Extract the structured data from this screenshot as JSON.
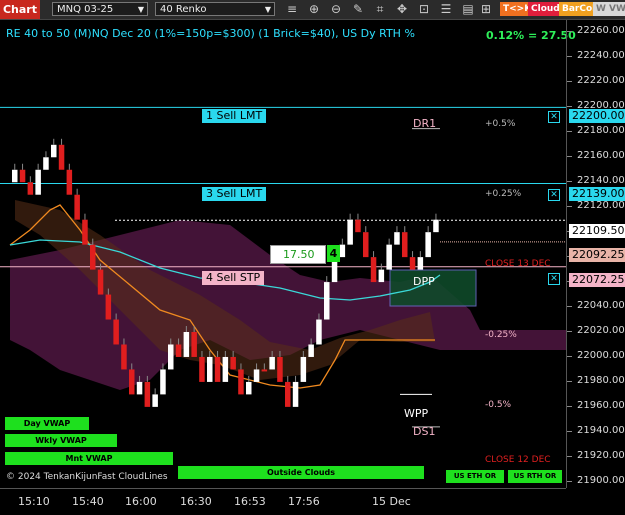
{
  "toolbar": {
    "chart_label": "Chart",
    "symbol": "MNQ 03-25",
    "bar_type": "40 Renko",
    "tags": [
      {
        "label": "T<>K",
        "bg": "#f07020",
        "fg": "#ffffff"
      },
      {
        "label": "Cloud",
        "bg": "#e01e3c",
        "fg": "#ffffff"
      },
      {
        "label": "BarCol",
        "bg": "#f0a020",
        "fg": "#ffffff"
      },
      {
        "label": "W VWA",
        "bg": "#d8d8d8",
        "fg": "#777777"
      }
    ]
  },
  "chart": {
    "title": "RE 40 to 50 (M)NQ Dec 20 (1%=150p=$300) (1 Brick=$40), US Dy RTH %",
    "pct_change": "0.12% = 27.50",
    "orders": [
      {
        "label": "1 Sell LMT",
        "price": "22200.00",
        "kind": "lmt"
      },
      {
        "label": "3 Sell LMT",
        "price": "22139.00",
        "kind": "lmt"
      },
      {
        "label": "4 Sell STP",
        "price": "22072.25",
        "kind": "stp"
      }
    ],
    "qty_value": "17.50",
    "qty_count": "4",
    "last_price": "22109.50",
    "close_13_price": "22092.25",
    "levels": {
      "dr1": "DR1",
      "dpp": "DPP",
      "wpp": "WPP",
      "ds1": "DS1",
      "p05": "+0.5%",
      "p025": "+0.25%",
      "m025": "-0.25%",
      "m05": "-0.5%",
      "close13": "CLOSE 13 DEC",
      "close12": "CLOSE 12 DEC"
    },
    "buttons": {
      "day_vwap": "Day VWAP",
      "wkly_vwap": "Wkly VWAP",
      "mnt_vwap": "Mnt VWAP",
      "outside_clouds": "Outside Clouds",
      "us_eth_or": "US ETH OR",
      "us_rth_or": "US RTH OR"
    },
    "footer_text": "© 2024 TenkanKijunFast CloudLines"
  },
  "chart_data": {
    "type": "line",
    "y_ticks": [
      "22260.00",
      "22240.00",
      "22220.00",
      "22200.00",
      "22180.00",
      "22160.00",
      "22140.00",
      "22120.00",
      "22100.00",
      "22080.00",
      "22060.00",
      "22040.00",
      "22020.00",
      "22000.00",
      "21980.00",
      "21960.00",
      "21940.00",
      "21920.00",
      "21900.00"
    ],
    "x_ticks": [
      "15:10",
      "15:40",
      "16:00",
      "16:30",
      "16:53",
      "17:56",
      "15 Dec"
    ],
    "ylim": [
      21895,
      22270
    ],
    "renko_closes": [
      22150,
      22140,
      22130,
      22150,
      22160,
      22170,
      22150,
      22130,
      22110,
      22090,
      22070,
      22050,
      22030,
      22010,
      21990,
      21970,
      21980,
      21960,
      21970,
      21990,
      22010,
      22000,
      22020,
      22000,
      21980,
      22000,
      21980,
      22000,
      21990,
      21970,
      21980,
      21990,
      21990,
      22000,
      21980,
      21960,
      21980,
      22000,
      22010,
      22030,
      22060,
      22080,
      22090,
      22110,
      22100,
      22080,
      22060,
      22070,
      22090,
      22100,
      22080,
      22070,
      22080,
      22100,
      22110
    ]
  }
}
